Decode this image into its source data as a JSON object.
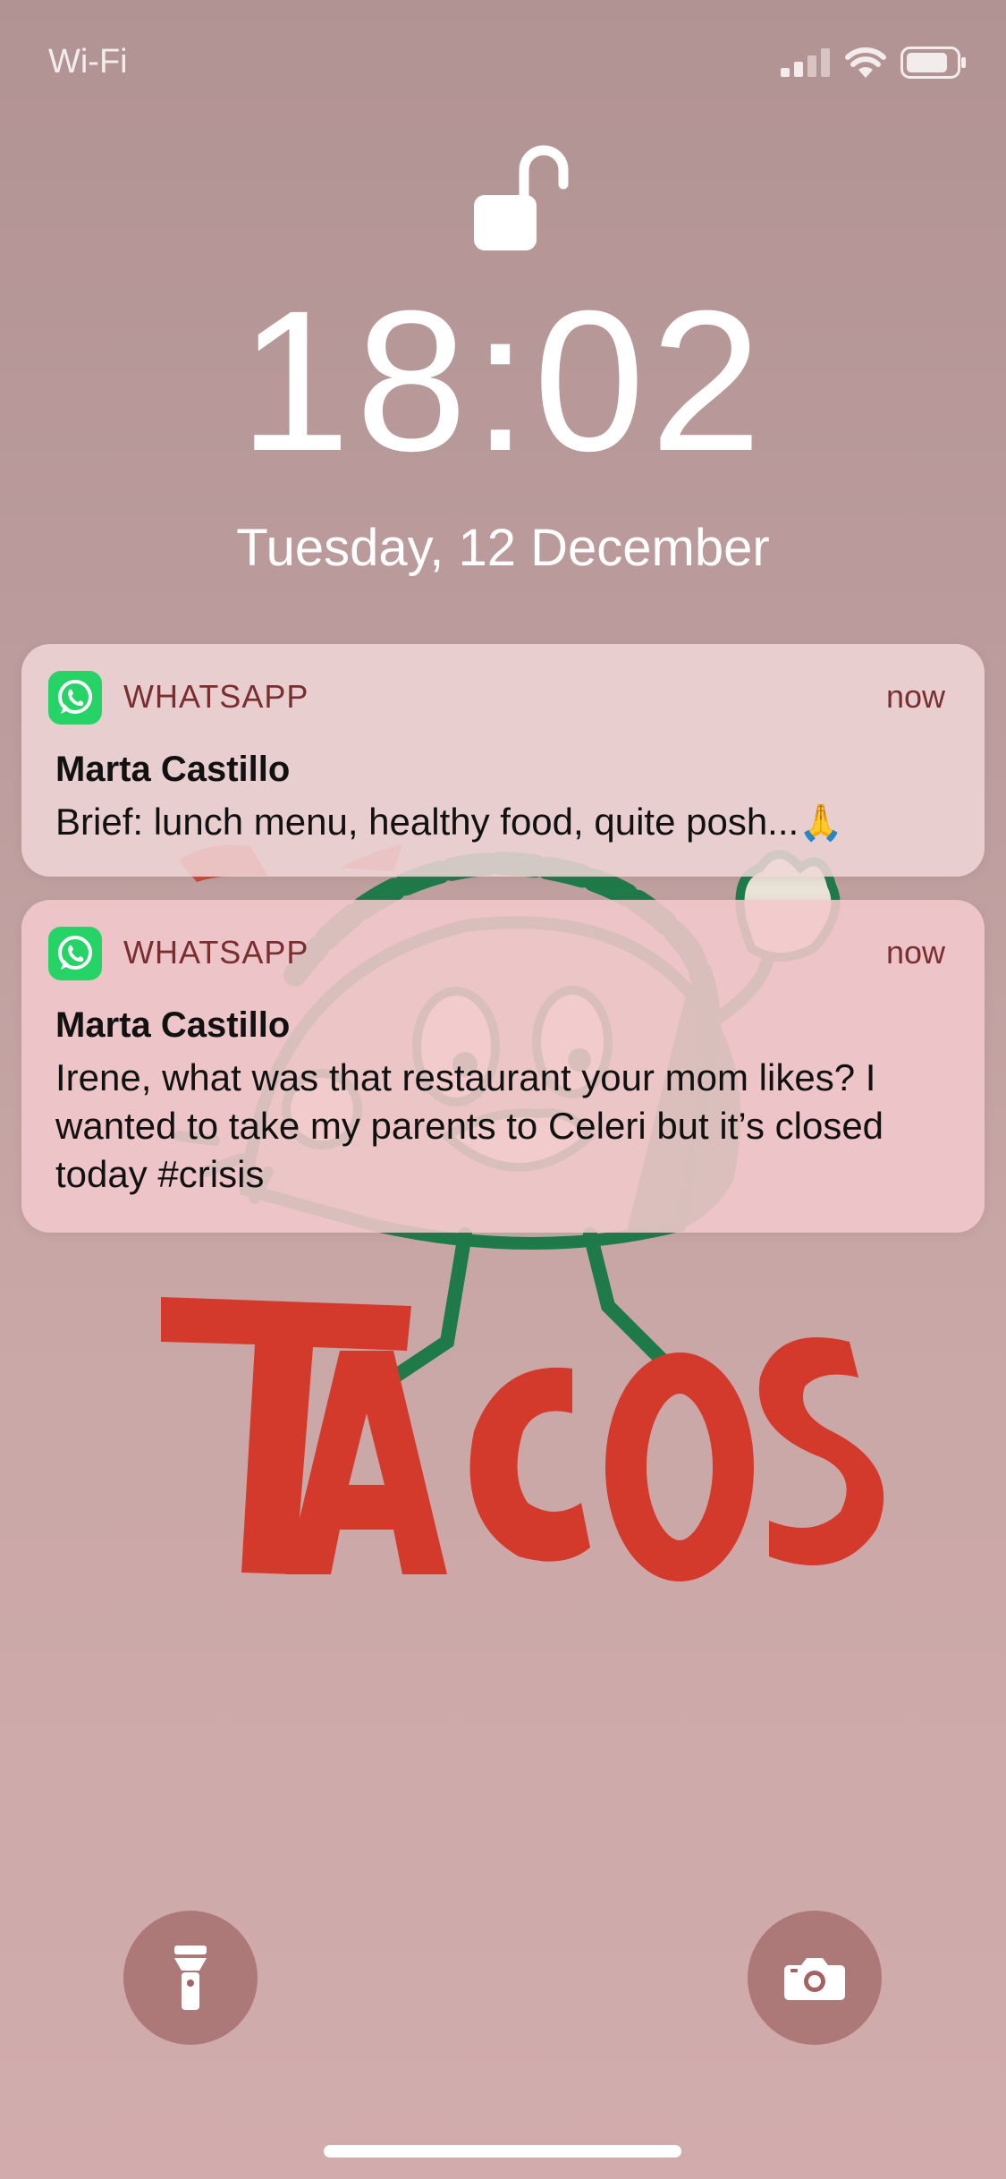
{
  "status_bar": {
    "carrier": "Wi-Fi",
    "icons": [
      "signal-icon",
      "wifi-icon",
      "battery-icon"
    ]
  },
  "lock_screen": {
    "lock_state": "unlocked",
    "time": "18:02",
    "date": "Tuesday, 12 December"
  },
  "notifications": [
    {
      "app": "WHATSAPP",
      "time": "now",
      "sender": "Marta Castillo",
      "message": "Brief: lunch menu, healthy food, quite posh...",
      "emoji": "🙏"
    },
    {
      "app": "WHATSAPP",
      "time": "now",
      "sender": "Marta Castillo",
      "message": "Irene, what was that restaurant your mom likes? I wanted to take my parents to Celeri but it’s closed today #crisis"
    }
  ],
  "wallpaper": {
    "text": "TACOS",
    "colors": {
      "green": "#1f7a4a",
      "red": "#d43a2b"
    }
  },
  "controls": {
    "left": "flashlight-icon",
    "right": "camera-icon"
  },
  "colors": {
    "whatsapp": "#25d366",
    "app_name_text": "#7a2f2f"
  }
}
